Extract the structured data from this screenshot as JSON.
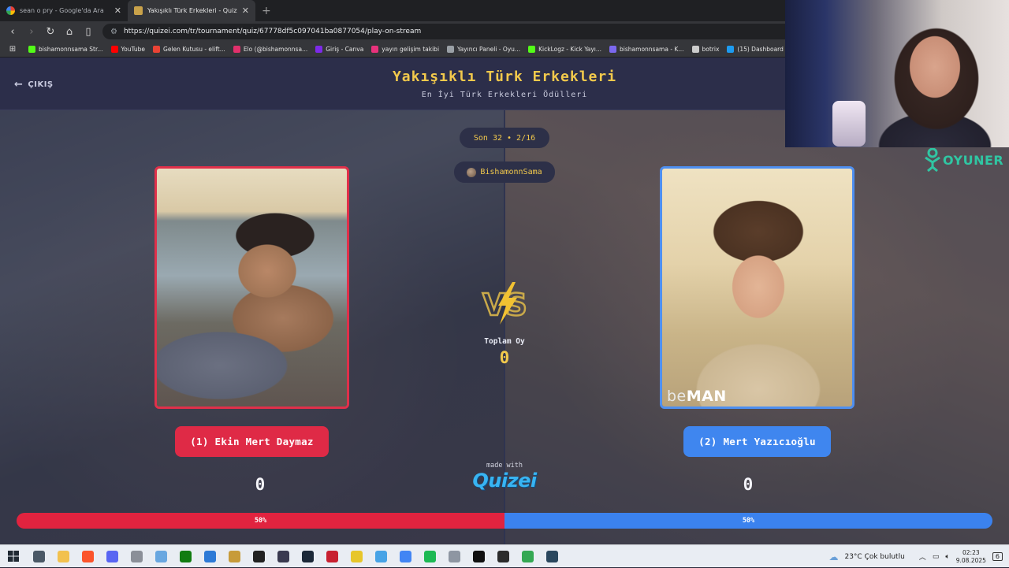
{
  "browser": {
    "tabs": [
      {
        "title": "sean o pry - Google'da Ara",
        "active": false
      },
      {
        "title": "Yakışıklı Türk Erkekleri - Quizei",
        "active": true
      }
    ],
    "url": "https://quizei.com/tr/tournament/quiz/67778df5c097041ba0877054/play-on-stream",
    "bookmarks": [
      "bishamonnsama Str...",
      "YouTube",
      "Gelen Kutusu - elift...",
      "Elo (@bishamonnsa...",
      "Giriş - Canva",
      "yayın gelişim takibi",
      "Yayıncı Paneli - Oyu...",
      "KickLogz - Kick Yayı...",
      "bishamonnsama - K...",
      "botrix",
      "(15) Dashboard / ..."
    ],
    "bookmark_colors": [
      "#53fc18",
      "#ff0000",
      "#ea4335",
      "#e1306c",
      "#7d2ae8",
      "#e8327c",
      "#9aa0a6",
      "#53fc18",
      "#7b68ee",
      "#cccccc",
      "#1d9bf0"
    ]
  },
  "page": {
    "exit_label": "ÇIKIŞ",
    "title": "Yakışıklı Türk Erkekleri",
    "subtitle": "En İyi Türk Erkekleri Ödülleri",
    "round": "Son 32 • 2/16",
    "host": "BishamonnSama",
    "total_label": "Toplam Oy",
    "total_value": "0",
    "made_with": "made with",
    "brand": "Quizei",
    "left": {
      "name": "(1) Ekin Mert Daymaz",
      "score": "0",
      "percent": "50%",
      "percent_value": 50,
      "color": "#e1233f"
    },
    "right": {
      "name": "(2) Mert Yazıcıoğlu",
      "score": "0",
      "percent": "50%",
      "percent_value": 50,
      "color": "#3b82ee"
    },
    "right_photo_text_light": "be",
    "right_photo_text_bold": "MAN"
  },
  "overlay": {
    "brand_text": "OYUNER"
  },
  "taskbar": {
    "weather": "23°C  Çok bulutlu",
    "time": "02:23",
    "date": "9.08.2025",
    "notif_count": "6",
    "icons": [
      {
        "name": "task-view-icon",
        "color": "#4a5866"
      },
      {
        "name": "file-explorer-icon",
        "color": "#f2c14e"
      },
      {
        "name": "brave-icon",
        "color": "#fb542b"
      },
      {
        "name": "discord-icon",
        "color": "#5865f2"
      },
      {
        "name": "app-icon",
        "color": "#8b8f98"
      },
      {
        "name": "paint-icon",
        "color": "#69a7e0"
      },
      {
        "name": "xbox-icon",
        "color": "#107c10"
      },
      {
        "name": "store-icon",
        "color": "#2d7ad6"
      },
      {
        "name": "app2-icon",
        "color": "#c79b3a"
      },
      {
        "name": "epic-games-icon",
        "color": "#222222"
      },
      {
        "name": "obs-icon",
        "color": "#3a3a50"
      },
      {
        "name": "steam-icon",
        "color": "#1b2838"
      },
      {
        "name": "record-icon",
        "color": "#c82030"
      },
      {
        "name": "app3-icon",
        "color": "#e7c62a"
      },
      {
        "name": "app4-icon",
        "color": "#47a3e6"
      },
      {
        "name": "chrome-icon",
        "color": "#4285f4"
      },
      {
        "name": "spotify-icon",
        "color": "#1db954"
      },
      {
        "name": "app5-icon",
        "color": "#8e96a2"
      },
      {
        "name": "notion-icon",
        "color": "#111111"
      },
      {
        "name": "app6-icon",
        "color": "#2b2b2b"
      },
      {
        "name": "chrome2-icon",
        "color": "#34a853"
      },
      {
        "name": "steam2-icon",
        "color": "#2a475e"
      }
    ]
  }
}
